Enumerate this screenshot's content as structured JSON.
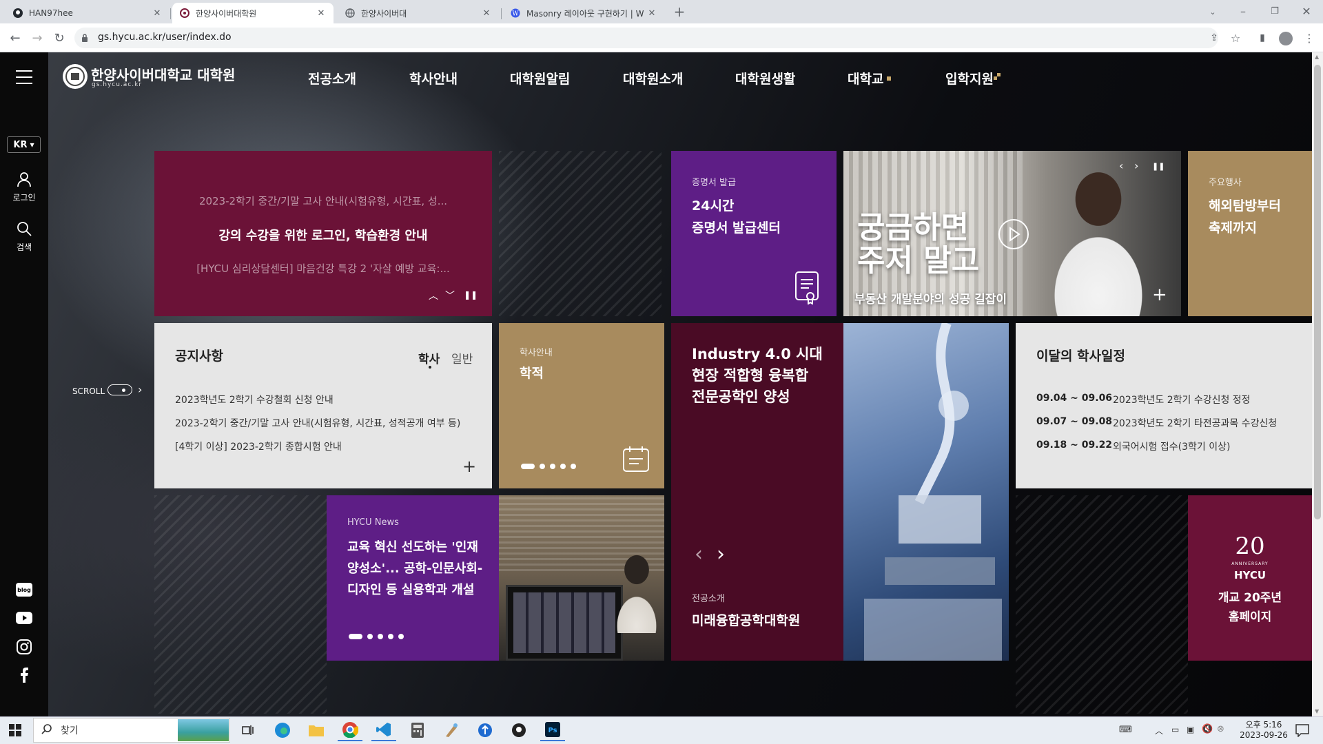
{
  "browser": {
    "tabs": [
      {
        "title": "HAN97hee"
      },
      {
        "title": "한양사이버대학원"
      },
      {
        "title": "한양사이버대"
      },
      {
        "title": "Masonry 레이아웃 구현하기 | W"
      }
    ],
    "url": "gs.hycu.ac.kr/user/index.do"
  },
  "site": {
    "logo_title": "한양사이버대학교 대학원",
    "logo_sub": "gs.hycu.ac.kr",
    "nav": [
      "전공소개",
      "학사안내",
      "대학원알림",
      "대학원소개",
      "대학원생활",
      "대학교",
      "입학지원"
    ],
    "lang": "KR",
    "login_label": "로그인",
    "search_label": "검색",
    "scroll_label": "SCROLL",
    "social": [
      "blog",
      "youtube",
      "instagram",
      "facebook"
    ]
  },
  "tiles": {
    "notice_rotator": {
      "line1": "2023-2학기 중간/기말 고사 안내(시험유형, 시간표, 성...",
      "line2": "강의 수강을 위한 로그인, 학습환경 안내",
      "line3": "[HYCU 심리상담센터] 마음건강 특강 2 '자살 예방 교육:..."
    },
    "certificate": {
      "label": "증명서 발급",
      "title1": "24시간",
      "title2": "증명서 발급센터"
    },
    "video": {
      "big1": "궁금하면",
      "big2": "주저 말고",
      "caption": "부동산 개발분야의 성공 길잡이"
    },
    "event": {
      "label": "주요행사",
      "title1": "해외탐방부터",
      "title2": "축제까지"
    },
    "notices": {
      "title": "공지사항",
      "tab1": "학사",
      "tab2": "일반",
      "items": [
        "2023학년도 2학기 수강철회 신청 안내",
        "2023-2학기 중간/기말 고사 안내(시험유형, 시간표, 성적공개 여부 등)",
        "[4학기 이상] 2023-2학기 종합시험 안내"
      ]
    },
    "academic": {
      "label": "학사안내",
      "title": "학적"
    },
    "industry": {
      "line1": "Industry 4.0 시대",
      "line2": "현장 적합형 융복합",
      "line3": "전문공학인 양성",
      "label": "전공소개",
      "title": "미래융합공학대학원"
    },
    "calendar": {
      "title": "이달의 학사일정",
      "items": [
        {
          "date": "09.04 ~ 09.06",
          "text": "2023학년도 2학기 수강신청 정정"
        },
        {
          "date": "09.07 ~ 09.08",
          "text": "2023학년도 2학기 타전공과목 수강신청"
        },
        {
          "date": "09.18 ~ 09.22",
          "text": "외국어시험 접수(3학기 이상)"
        }
      ]
    },
    "news": {
      "label": "HYCU News",
      "line1": "교육 혁신 선도하는 '인재",
      "line2": "양성소'... 공학-인문사회-",
      "line3": "디자인 등 실용학과 개설"
    },
    "anniv": {
      "num": "20",
      "sub": "ANNIVERSARY",
      "brand": "HYCU",
      "line1": "개교 20주년",
      "line2": "홈페이지"
    }
  },
  "taskbar": {
    "search": "찾기",
    "time": "오후 5:16",
    "date": "2023-09-26"
  },
  "colors": {
    "maroon": "#6b1237",
    "purple": "#5e1e86",
    "tan": "#a88b5e",
    "light": "#e6e6e6",
    "dark_maroon": "#4a0b25"
  }
}
